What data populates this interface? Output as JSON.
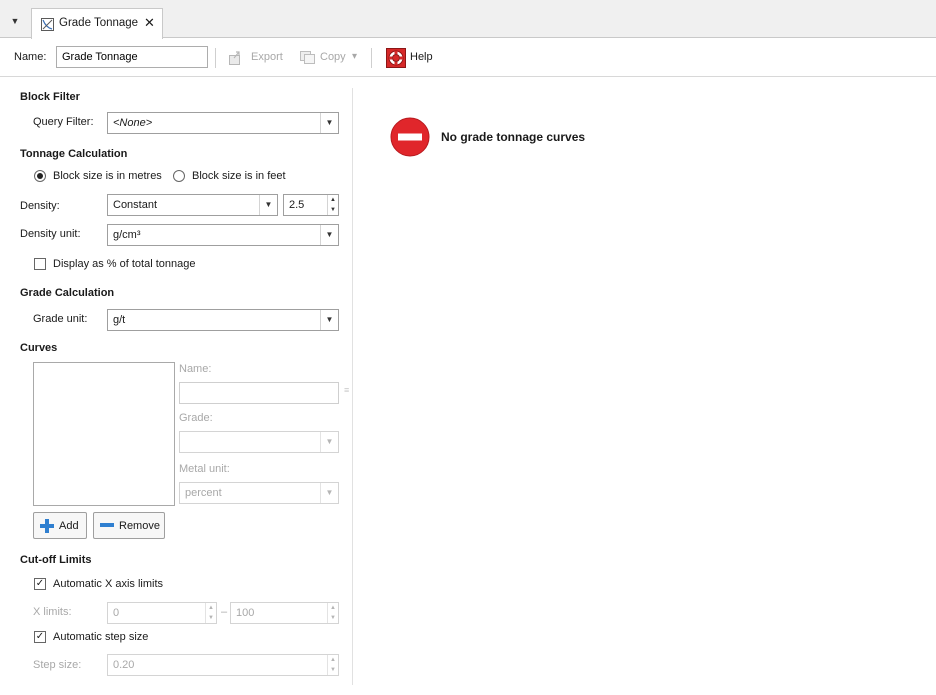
{
  "tab": {
    "title": "Grade Tonnage",
    "close": "✕",
    "menu": "▼"
  },
  "toolbar": {
    "name_label": "Name:",
    "name_value": "Grade Tonnage",
    "export_label": "Export",
    "copy_label": "Copy",
    "copy_arrow": "▾",
    "help_label": "Help"
  },
  "block_filter": {
    "heading": "Block Filter",
    "query_label": "Query Filter:",
    "query_value": "<None>"
  },
  "tonnage": {
    "heading": "Tonnage Calculation",
    "radio_metres": "Block size is in metres",
    "radio_feet": "Block size is in feet",
    "metres_selected": true,
    "density_label": "Density:",
    "density_mode": "Constant",
    "density_value": "2.5",
    "density_unit_label": "Density unit:",
    "density_unit_value": "g/cm³",
    "display_pct_label": "Display as % of total tonnage",
    "display_pct_checked": false
  },
  "grade": {
    "heading": "Grade Calculation",
    "unit_label": "Grade unit:",
    "unit_value": "g/t"
  },
  "curves": {
    "heading": "Curves",
    "name_label": "Name:",
    "grade_label": "Grade:",
    "metal_unit_label": "Metal unit:",
    "metal_unit_value": "percent",
    "add_label": "Add",
    "remove_label": "Remove"
  },
  "cutoff": {
    "heading": "Cut-off Limits",
    "auto_x_label": "Automatic X axis limits",
    "auto_x_checked": true,
    "x_limits_label": "X limits:",
    "x_min": "0",
    "x_sep": "–",
    "x_max": "100",
    "auto_step_label": "Automatic step size",
    "auto_step_checked": true,
    "step_label": "Step size:",
    "step_value": "0.20"
  },
  "main": {
    "empty_message": "No grade tonnage curves"
  },
  "colors": {
    "no_entry_red": "#e0262b",
    "add_blue": "#2f7fd0"
  }
}
